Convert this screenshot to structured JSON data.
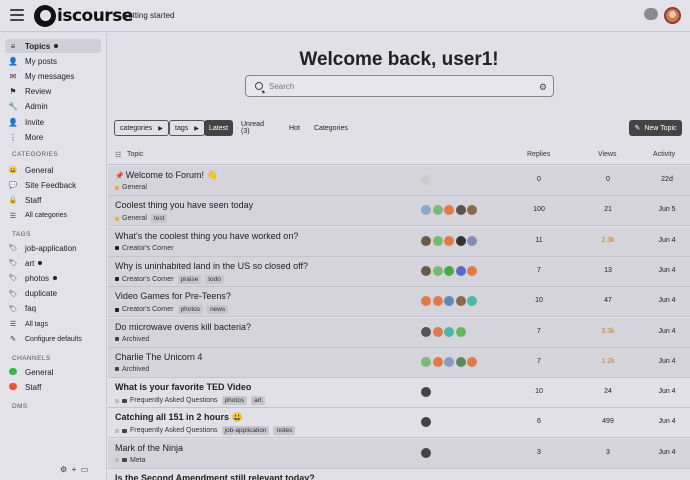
{
  "header": {
    "logo_text": "iscourse",
    "getting_started": "Getting started",
    "chat_icon": "chat-bubble-icon",
    "avatar_icon": "user-avatar"
  },
  "sidebar": {
    "items": [
      {
        "label": "Topics",
        "icon": "≡",
        "active": true,
        "dot": true
      },
      {
        "label": "My posts",
        "icon": "👤"
      },
      {
        "label": "My messages",
        "icon": "✉"
      },
      {
        "label": "Review",
        "icon": "⚑"
      },
      {
        "label": "Admin",
        "icon": "🔧"
      },
      {
        "label": "Invite",
        "icon": "👤"
      },
      {
        "label": "More",
        "icon": "⋮"
      }
    ],
    "categories_head": "CATEGORIES",
    "categories": [
      {
        "label": "General",
        "icon": "😀"
      },
      {
        "label": "Site Feedback",
        "icon": "💬"
      },
      {
        "label": "Staff",
        "icon": "🔒"
      },
      {
        "label": "All categories",
        "icon": "☰"
      }
    ],
    "tags_head": "TAGS",
    "tags": [
      {
        "label": "job-application",
        "dot": false
      },
      {
        "label": "art",
        "dot": true
      },
      {
        "label": "photos",
        "dot": true
      },
      {
        "label": "duplicate",
        "dot": false
      },
      {
        "label": "faq",
        "dot": false
      },
      {
        "label": "All tags",
        "dot": false
      },
      {
        "label": "Configure defaults",
        "dot": false
      }
    ],
    "channels_head": "CHANNELS",
    "channels": [
      {
        "label": "General",
        "color": "#3ab54a"
      },
      {
        "label": "Staff",
        "color": "#e45735"
      }
    ],
    "dms_head": "DMS"
  },
  "main": {
    "welcome": "Welcome back, user1!",
    "search_placeholder": "Search",
    "nav": {
      "categories": "categories",
      "tags": "tags",
      "tabs": [
        "Latest",
        "Unread (3)",
        "Hot",
        "Categories"
      ],
      "new_topic": "New Topic"
    },
    "columns": {
      "topic": "Topic",
      "replies": "Replies",
      "views": "Views",
      "activity": "Activity"
    },
    "topics": [
      {
        "title": "Welcome to Forum! 👋",
        "pin": true,
        "unread": true,
        "bold": false,
        "category": "General",
        "cat_color": "#e8b23a",
        "tags": [],
        "avatars": [
          "#cccccc"
        ],
        "replies": "0",
        "views": "0",
        "hot": false,
        "activity": "22d"
      },
      {
        "title": "Coolest thing you have seen today",
        "unread": true,
        "bold": false,
        "category": "General",
        "cat_color": "#e8b23a",
        "tags": [
          "test"
        ],
        "avatars": [
          "#8aa8c8",
          "#7ab87a",
          "#e07a4a",
          "#555555",
          "#8a6a4a"
        ],
        "replies": "100",
        "views": "21",
        "hot": false,
        "activity": "Jun 5"
      },
      {
        "title": "What's the coolest thing you have worked on?",
        "unread": true,
        "bold": false,
        "category": "Creator's Corner",
        "cat_color": "#222222",
        "tags": [],
        "avatars": [
          "#6a5a4a",
          "#7ab87a",
          "#e07a4a",
          "#333333",
          "#8a8ab8"
        ],
        "replies": "11",
        "views": "2.3k",
        "hot": true,
        "activity": "Jun 4"
      },
      {
        "title": "Why is uninhabited land in the US so closed off?",
        "unread": true,
        "bold": false,
        "category": "Creator's Corner",
        "cat_color": "#222222",
        "tags": [
          "praise",
          "todo"
        ],
        "avatars": [
          "#6a5a4a",
          "#7ab87a",
          "#4aa84a",
          "#5a6ac8",
          "#e07a4a"
        ],
        "replies": "7",
        "views": "13",
        "hot": false,
        "activity": "Jun 4"
      },
      {
        "title": "Video Games for Pre-Teens?",
        "unread": true,
        "bold": false,
        "category": "Creator's Corner",
        "cat_color": "#222222",
        "tags": [
          "photos",
          "news"
        ],
        "avatars": [
          "#e07a4a",
          "#e07a4a",
          "#5a8ab8",
          "#8a6a4a",
          "#4ab8a8"
        ],
        "replies": "10",
        "views": "47",
        "hot": false,
        "activity": "Jun 4"
      },
      {
        "title": "Do microwave ovens kill bacteria?",
        "unread": true,
        "bold": false,
        "category": "Archived",
        "cat_color": "#444444",
        "tags": [],
        "avatars": [
          "#555555",
          "#e07a4a",
          "#4ab8a8",
          "#6ab85a"
        ],
        "replies": "7",
        "views": "3.3k",
        "hot": true,
        "activity": "Jun 4"
      },
      {
        "title": "Charlie The Unicorn 4",
        "unread": true,
        "bold": false,
        "category": "Archived",
        "cat_color": "#444444",
        "tags": [],
        "avatars": [
          "#7ab87a",
          "#e07a4a",
          "#8a9ac8",
          "#5a8a5a",
          "#e07a4a"
        ],
        "replies": "7",
        "views": "1.2k",
        "hot": true,
        "activity": "Jun 4"
      },
      {
        "title": "What is your favorite TED Video",
        "unread": false,
        "bold": true,
        "locked": true,
        "category": "Frequently Asked Questions",
        "cat_color": "#bbbbbb",
        "tags": [
          "photos",
          "art"
        ],
        "avatars": [
          "#444444"
        ],
        "replies": "10",
        "views": "24",
        "hot": false,
        "activity": "Jun 4"
      },
      {
        "title": "Catching all 151 in 2 hours 😃",
        "unread": false,
        "bold": true,
        "locked": true,
        "category": "Frequently Asked Questions",
        "cat_color": "#bbbbbb",
        "tags": [
          "job-application",
          "notes"
        ],
        "avatars": [
          "#444444"
        ],
        "replies": "6",
        "views": "499",
        "hot": false,
        "activity": "Jun 4"
      },
      {
        "title": "Mark of the Ninja",
        "unread": true,
        "bold": false,
        "locked": true,
        "category": "Meta",
        "cat_color": "#bbbbbb",
        "tags": [],
        "avatars": [
          "#444444"
        ],
        "replies": "3",
        "views": "3",
        "hot": false,
        "activity": "Jun 4"
      },
      {
        "title": "Is the Second Amendment still relevant today?",
        "unread": false,
        "bold": true,
        "category": "",
        "cat_color": "#bbbbbb",
        "tags": [],
        "avatars": [],
        "replies": "",
        "views": "",
        "hot": false,
        "activity": ""
      }
    ]
  }
}
